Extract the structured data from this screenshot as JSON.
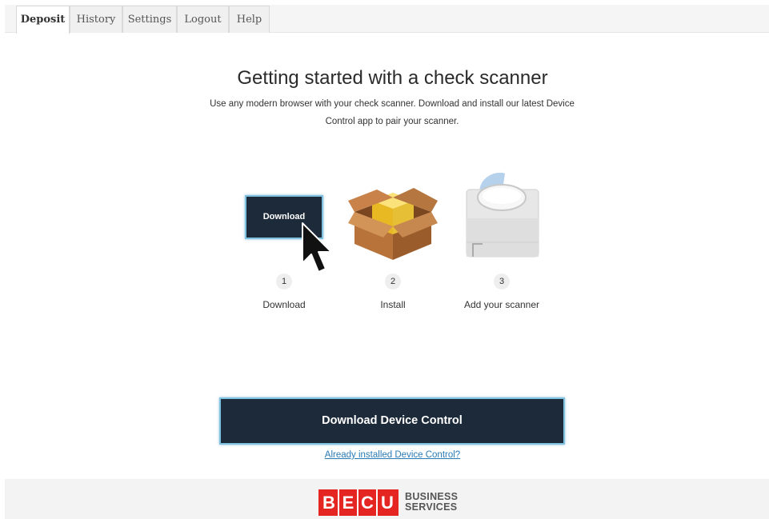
{
  "tabs": [
    {
      "label": "Deposit",
      "active": true
    },
    {
      "label": "History",
      "active": false
    },
    {
      "label": "Settings",
      "active": false
    },
    {
      "label": "Logout",
      "active": false
    },
    {
      "label": "Help",
      "active": false
    }
  ],
  "header": {
    "title": "Getting started with a check scanner",
    "subtitle": "Use any modern browser with your check scanner. Download and install our latest Device Control app to pair your scanner."
  },
  "steps": [
    {
      "number": "1",
      "label": "Download",
      "button_label": "Download"
    },
    {
      "number": "2",
      "label": "Install",
      "icon": "package-box-icon"
    },
    {
      "number": "3",
      "label": "Add your scanner",
      "icon": "check-scanner-icon"
    }
  ],
  "main_button": {
    "label": "Download Device Control"
  },
  "secondary_link": {
    "label": "Already installed Device Control?"
  },
  "footer": {
    "logo_letters": [
      "B",
      "E",
      "C",
      "U"
    ],
    "logo_text_line1": "BUSINESS",
    "logo_text_line2": "SERVICES"
  },
  "colors": {
    "button_bg": "#1d2a3a",
    "button_border": "#7fc2e0",
    "link": "#2a7ab5",
    "brand_red": "#e52521"
  }
}
